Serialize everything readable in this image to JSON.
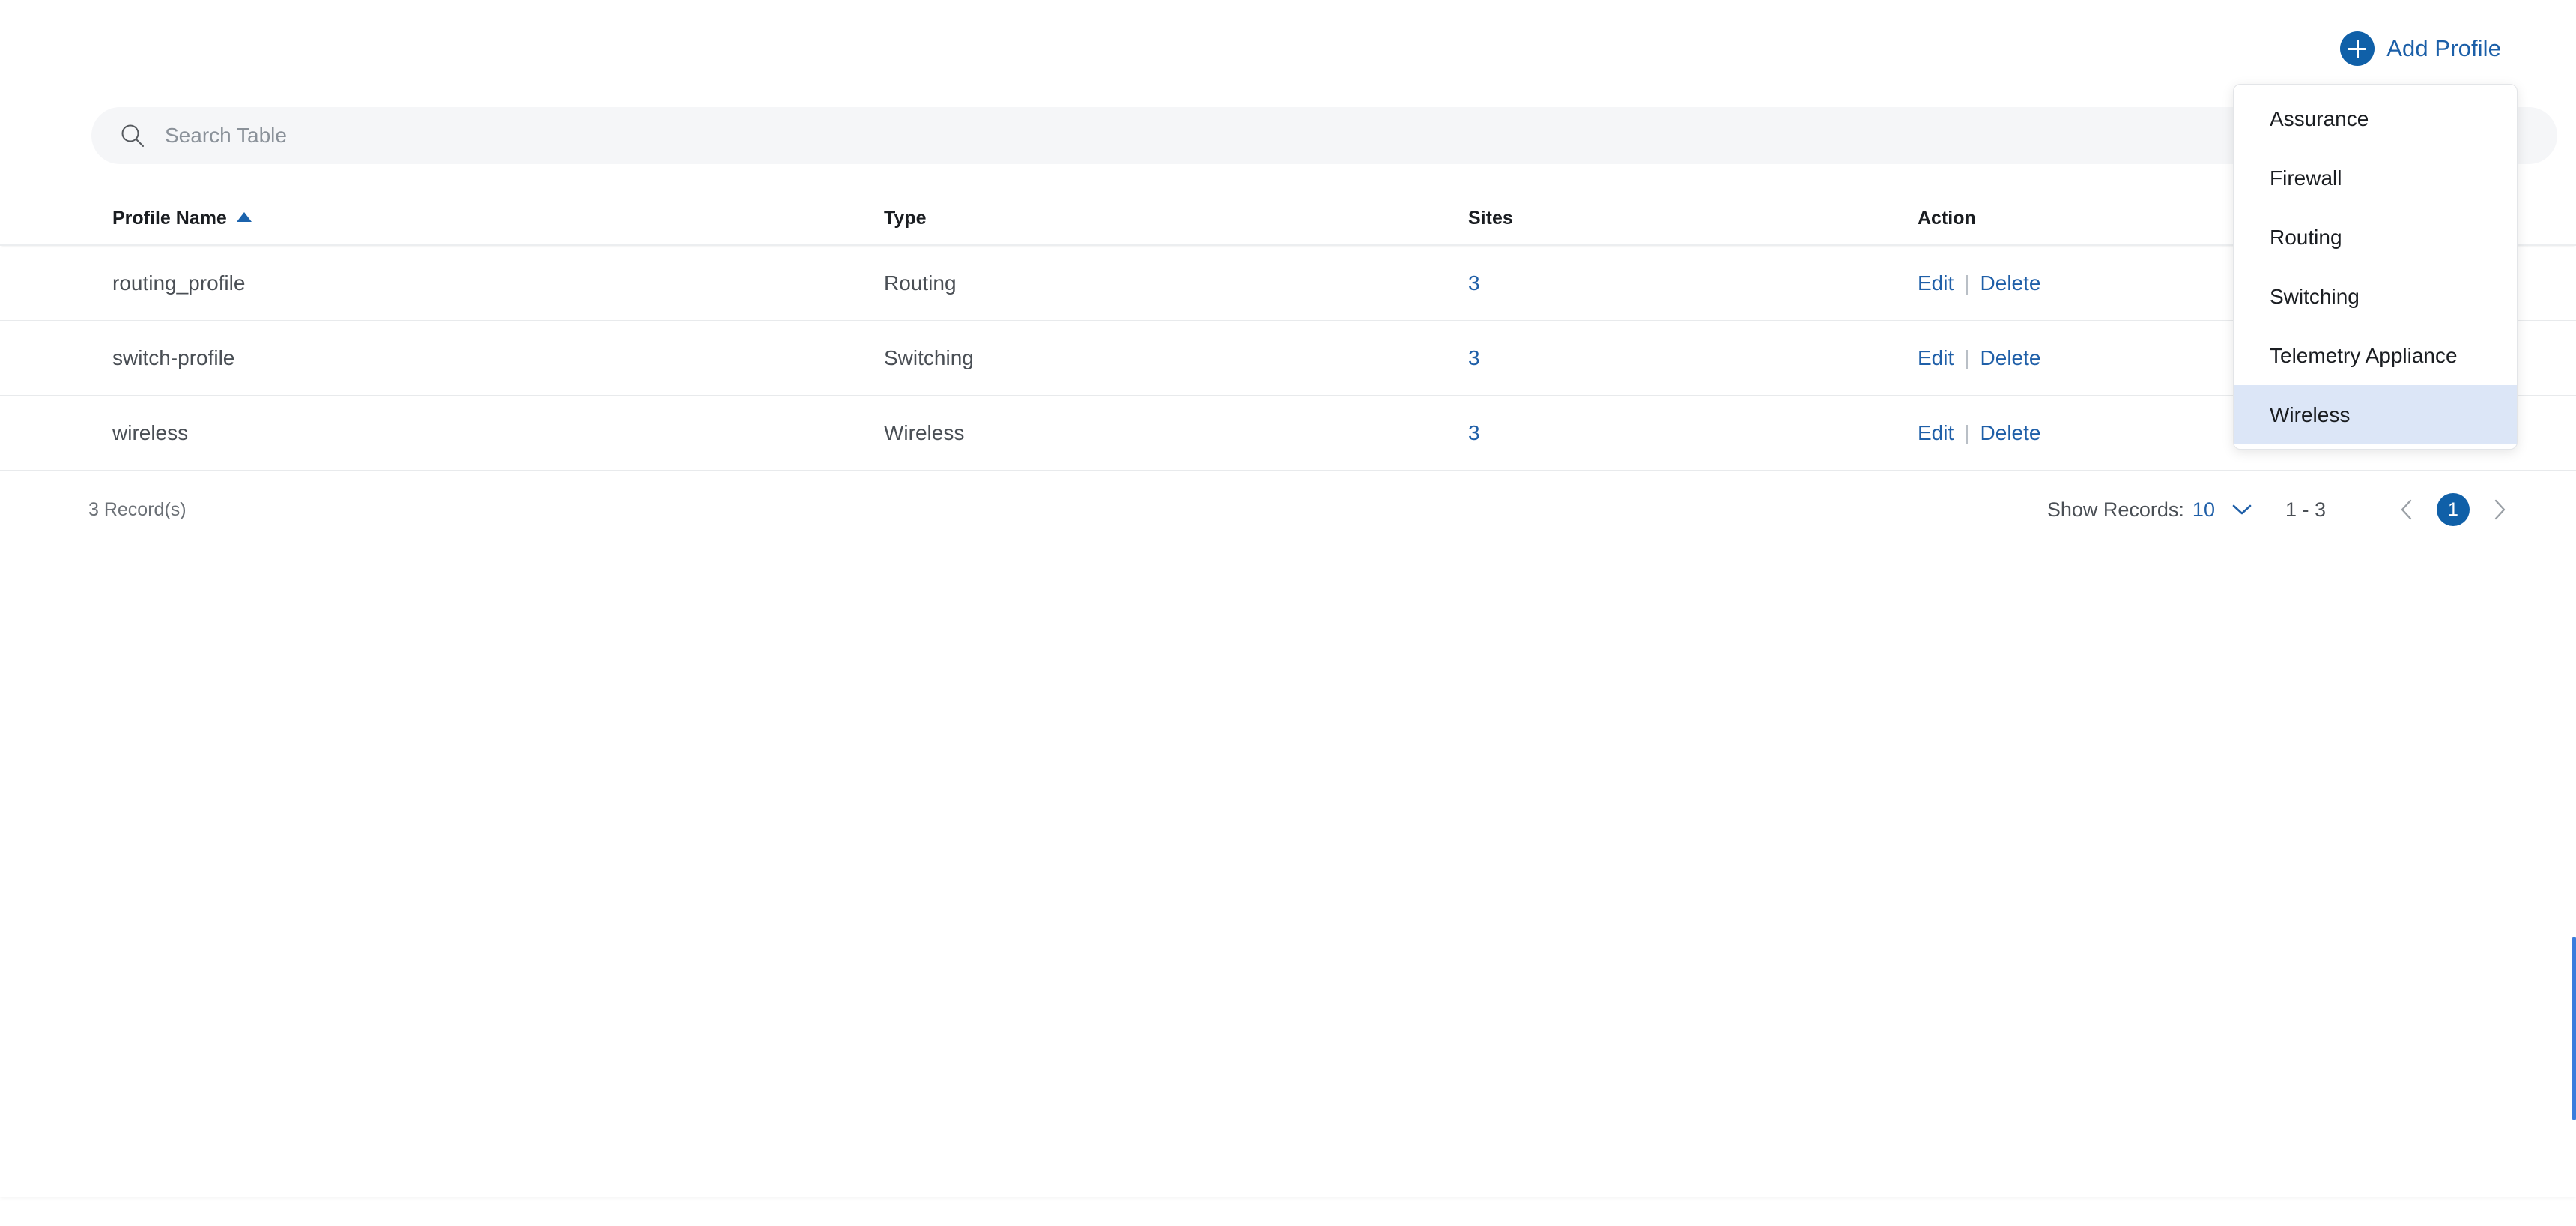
{
  "toolbar": {
    "add_profile_label": "Add Profile",
    "add_profile_icon": "plus-circle-icon"
  },
  "search": {
    "placeholder": "Search Table",
    "value": "",
    "icon": "search-icon"
  },
  "table": {
    "columns": [
      {
        "key": "profile_name",
        "label": "Profile Name",
        "sorted": "asc"
      },
      {
        "key": "type",
        "label": "Type",
        "sorted": ""
      },
      {
        "key": "sites",
        "label": "Sites",
        "sorted": ""
      },
      {
        "key": "action",
        "label": "Action",
        "sorted": ""
      }
    ],
    "rows": [
      {
        "profile_name": "routing_profile",
        "type": "Routing",
        "sites": "3",
        "edit": "Edit",
        "sep": "|",
        "delete": "Delete"
      },
      {
        "profile_name": "switch-profile",
        "type": "Switching",
        "sites": "3",
        "edit": "Edit",
        "sep": "|",
        "delete": "Delete"
      },
      {
        "profile_name": "wireless",
        "type": "Wireless",
        "sites": "3",
        "edit": "Edit",
        "sep": "|",
        "delete": "Delete"
      }
    ]
  },
  "footer": {
    "record_count": "3 Record(s)",
    "show_records_label": "Show Records:",
    "show_records_value": "10",
    "range": "1 - 3",
    "current_page": "1",
    "prev_icon": "chevron-left-icon",
    "next_icon": "chevron-right-icon",
    "dropdown_icon": "chevron-down-icon"
  },
  "dropdown": {
    "items": [
      {
        "label": "Assurance",
        "selected": false
      },
      {
        "label": "Firewall",
        "selected": false
      },
      {
        "label": "Routing",
        "selected": false
      },
      {
        "label": "Switching",
        "selected": false
      },
      {
        "label": "Telemetry Appliance",
        "selected": false
      },
      {
        "label": "Wireless",
        "selected": true
      }
    ]
  },
  "colors": {
    "accent_blue": "#1060a8",
    "link_blue": "#1f5fa8",
    "highlight_blue": "#dce6f7",
    "search_bg": "#f5f6f8",
    "scrollbar_blue": "#3b7ddd"
  }
}
